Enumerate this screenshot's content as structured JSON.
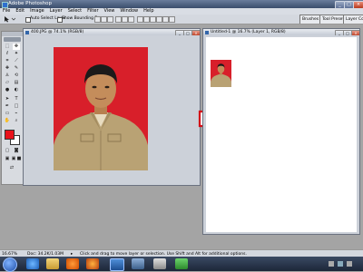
{
  "app": {
    "title": "Adobe Photoshop",
    "window_controls": {
      "minimize": "_",
      "restore": "□",
      "close": "×"
    }
  },
  "menu": [
    "File",
    "Edit",
    "Image",
    "Layer",
    "Select",
    "Filter",
    "View",
    "Window",
    "Help"
  ],
  "options_bar": {
    "auto_select_layer": "Auto Select Layer",
    "show_bounding_box": "Show Bounding Box",
    "panel_tabs": [
      "Brushes",
      "Tool Presets",
      "Layer Co"
    ]
  },
  "doc_left": {
    "title": "400.JPG @ 74.1% (RGB/8)"
  },
  "doc_right": {
    "title": "Untitled-1 @ 16.7% (Layer 1, RGB/8)"
  },
  "status": {
    "zoom": "16.67%",
    "doc_size": "Doc: 34.2K/1.03M",
    "hint": "Click and drag to move layer or selection.  Use Shift and Alt for additional options."
  },
  "taskbar": {
    "icons": [
      "start-orb-icon",
      "ie-icon",
      "explorer-icon",
      "media-player-icon",
      "firefox-icon",
      "photoshop-icon",
      "app-icon",
      "app2-icon",
      "app3-icon"
    ]
  },
  "colors": {
    "photo_background": "#d81f2a",
    "arrow_stroke": "#d40e17",
    "foreground_swatch": "#e8121b",
    "background_swatch": "#ffffff"
  }
}
